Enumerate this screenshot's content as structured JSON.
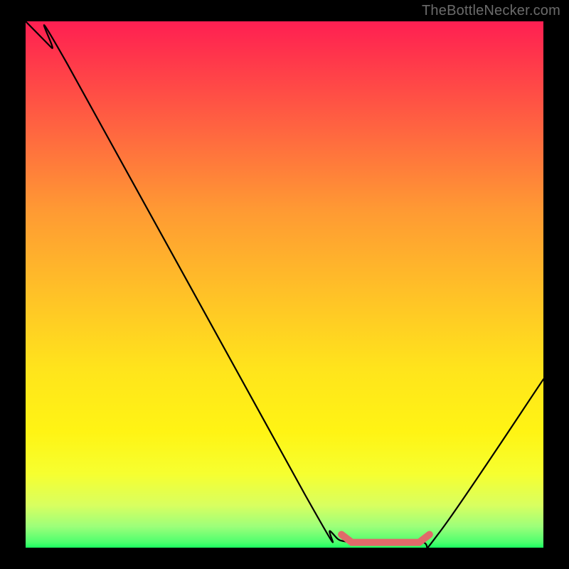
{
  "watermark": "TheBottleNecker.com",
  "chart_data": {
    "type": "line",
    "title": "",
    "xlabel": "",
    "ylabel": "",
    "xlim": [
      0,
      100
    ],
    "ylim": [
      0,
      100
    ],
    "grid": false,
    "curve_points": [
      {
        "x": 0,
        "y": 100
      },
      {
        "x": 5,
        "y": 95
      },
      {
        "x": 8,
        "y": 92
      },
      {
        "x": 54,
        "y": 10
      },
      {
        "x": 59,
        "y": 3
      },
      {
        "x": 63,
        "y": 1
      },
      {
        "x": 76,
        "y": 1
      },
      {
        "x": 80,
        "y": 3
      },
      {
        "x": 100,
        "y": 32
      }
    ],
    "highlight_segment": {
      "color": "#e06a6a",
      "points": [
        {
          "x": 61,
          "y": 2.5
        },
        {
          "x": 63,
          "y": 1
        },
        {
          "x": 76,
          "y": 1
        },
        {
          "x": 78,
          "y": 2.5
        }
      ]
    },
    "gradient_stops": [
      {
        "pos": 0.0,
        "color": "#ff1f52"
      },
      {
        "pos": 0.08,
        "color": "#ff3a4a"
      },
      {
        "pos": 0.22,
        "color": "#ff6a3f"
      },
      {
        "pos": 0.36,
        "color": "#ff9a33"
      },
      {
        "pos": 0.52,
        "color": "#ffc227"
      },
      {
        "pos": 0.66,
        "color": "#ffe41c"
      },
      {
        "pos": 0.78,
        "color": "#fff414"
      },
      {
        "pos": 0.86,
        "color": "#f6ff30"
      },
      {
        "pos": 0.92,
        "color": "#d8ff60"
      },
      {
        "pos": 0.96,
        "color": "#9cff7a"
      },
      {
        "pos": 0.99,
        "color": "#4dff6e"
      },
      {
        "pos": 1.0,
        "color": "#1aff60"
      }
    ]
  }
}
